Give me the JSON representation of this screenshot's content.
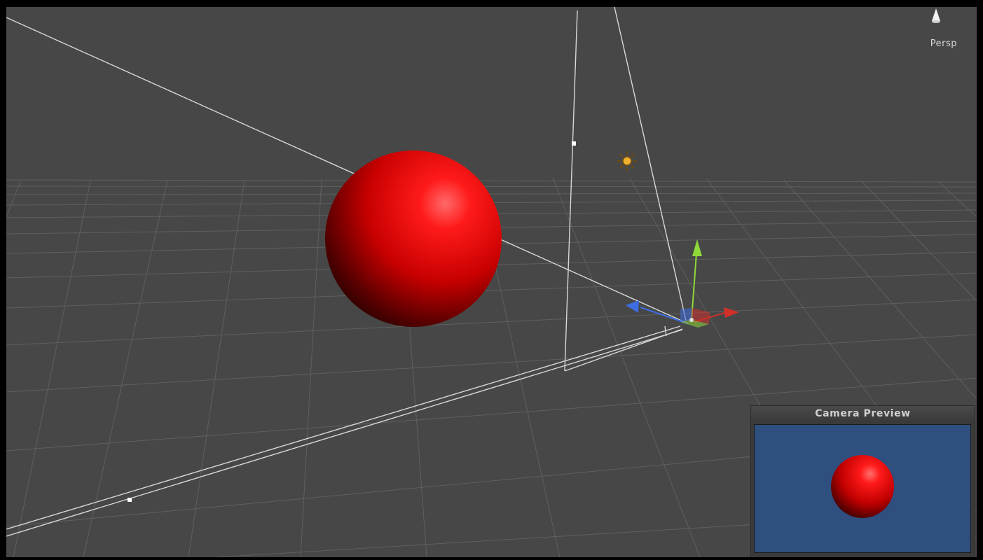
{
  "scene_view": {
    "projection_label": "Persp"
  },
  "camera_preview": {
    "title": "Camera Preview"
  },
  "colors": {
    "sky": "#474747",
    "preview_background": "#2f4f7f",
    "sphere": "#e00000",
    "axis_x": "#d0302a",
    "axis_y": "#8fd83a",
    "axis_z": "#3d6de0",
    "light_gizmo": "#f0b030"
  },
  "icons": {
    "orientation": "scene-orientation-icon",
    "light": "directional-light-icon",
    "move_tool": "move-tool-gizmo-icon"
  }
}
